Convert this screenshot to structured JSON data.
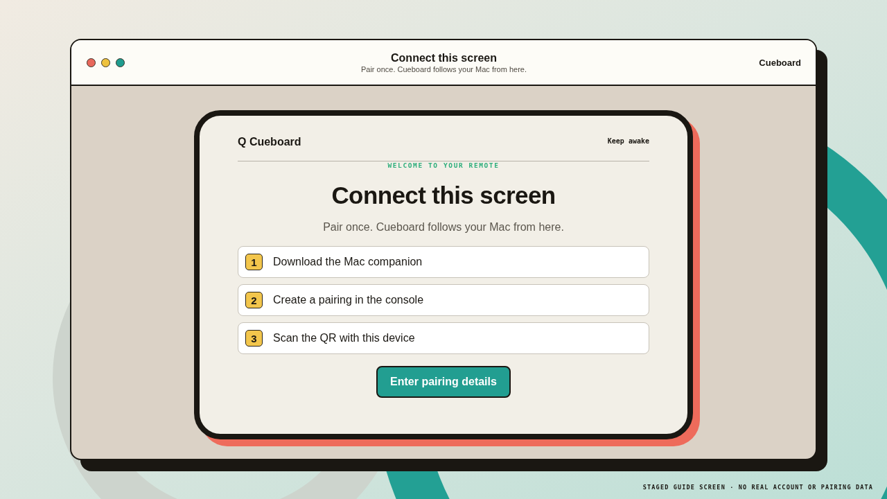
{
  "window": {
    "controls": [
      {
        "color": "#e8685c"
      },
      {
        "color": "#eec23f"
      },
      {
        "color": "#1f9c8f"
      }
    ],
    "title": "Connect this screen",
    "subtitle": "Pair once. Cueboard follows your Mac from here.",
    "app_name": "Cueboard"
  },
  "card": {
    "brand": "Q Cueboard",
    "keep_awake": "Keep awake",
    "eyebrow": "WELCOME TO YOUR REMOTE",
    "heading": "Connect this screen",
    "subheading": "Pair once. Cueboard follows your Mac from here.",
    "steps": [
      {
        "number": "1",
        "label": "Download the Mac companion"
      },
      {
        "number": "2",
        "label": "Create a pairing in the console"
      },
      {
        "number": "3",
        "label": "Scan the QR with this device"
      }
    ],
    "primary_button": "Enter pairing details"
  },
  "footer_note": "STAGED GUIDE SCREEN · NO REAL ACCOUNT OR PAIRING DATA"
}
